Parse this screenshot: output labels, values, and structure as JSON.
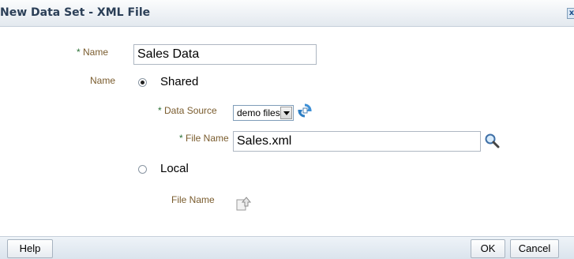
{
  "dialog": {
    "title": "New Data Set - XML File",
    "close_glyph": "x"
  },
  "form": {
    "name_label": "Name",
    "name_required": "*",
    "name_value": "Sales Data",
    "location_label": "Name",
    "shared_label": "Shared",
    "shared_selected": true,
    "data_source_label": "Data Source",
    "data_source_required": "*",
    "data_source_value": "demo files",
    "file_name_label": "File Name",
    "file_name_required": "*",
    "file_name_value": "Sales.xml",
    "local_label": "Local",
    "local_selected": false,
    "local_file_name_label": "File Name"
  },
  "icons": {
    "refresh": "refresh-icon",
    "search": "search-icon",
    "upload": "upload-icon"
  },
  "footer": {
    "help_label": "Help",
    "ok_label": "OK",
    "cancel_label": "Cancel"
  }
}
